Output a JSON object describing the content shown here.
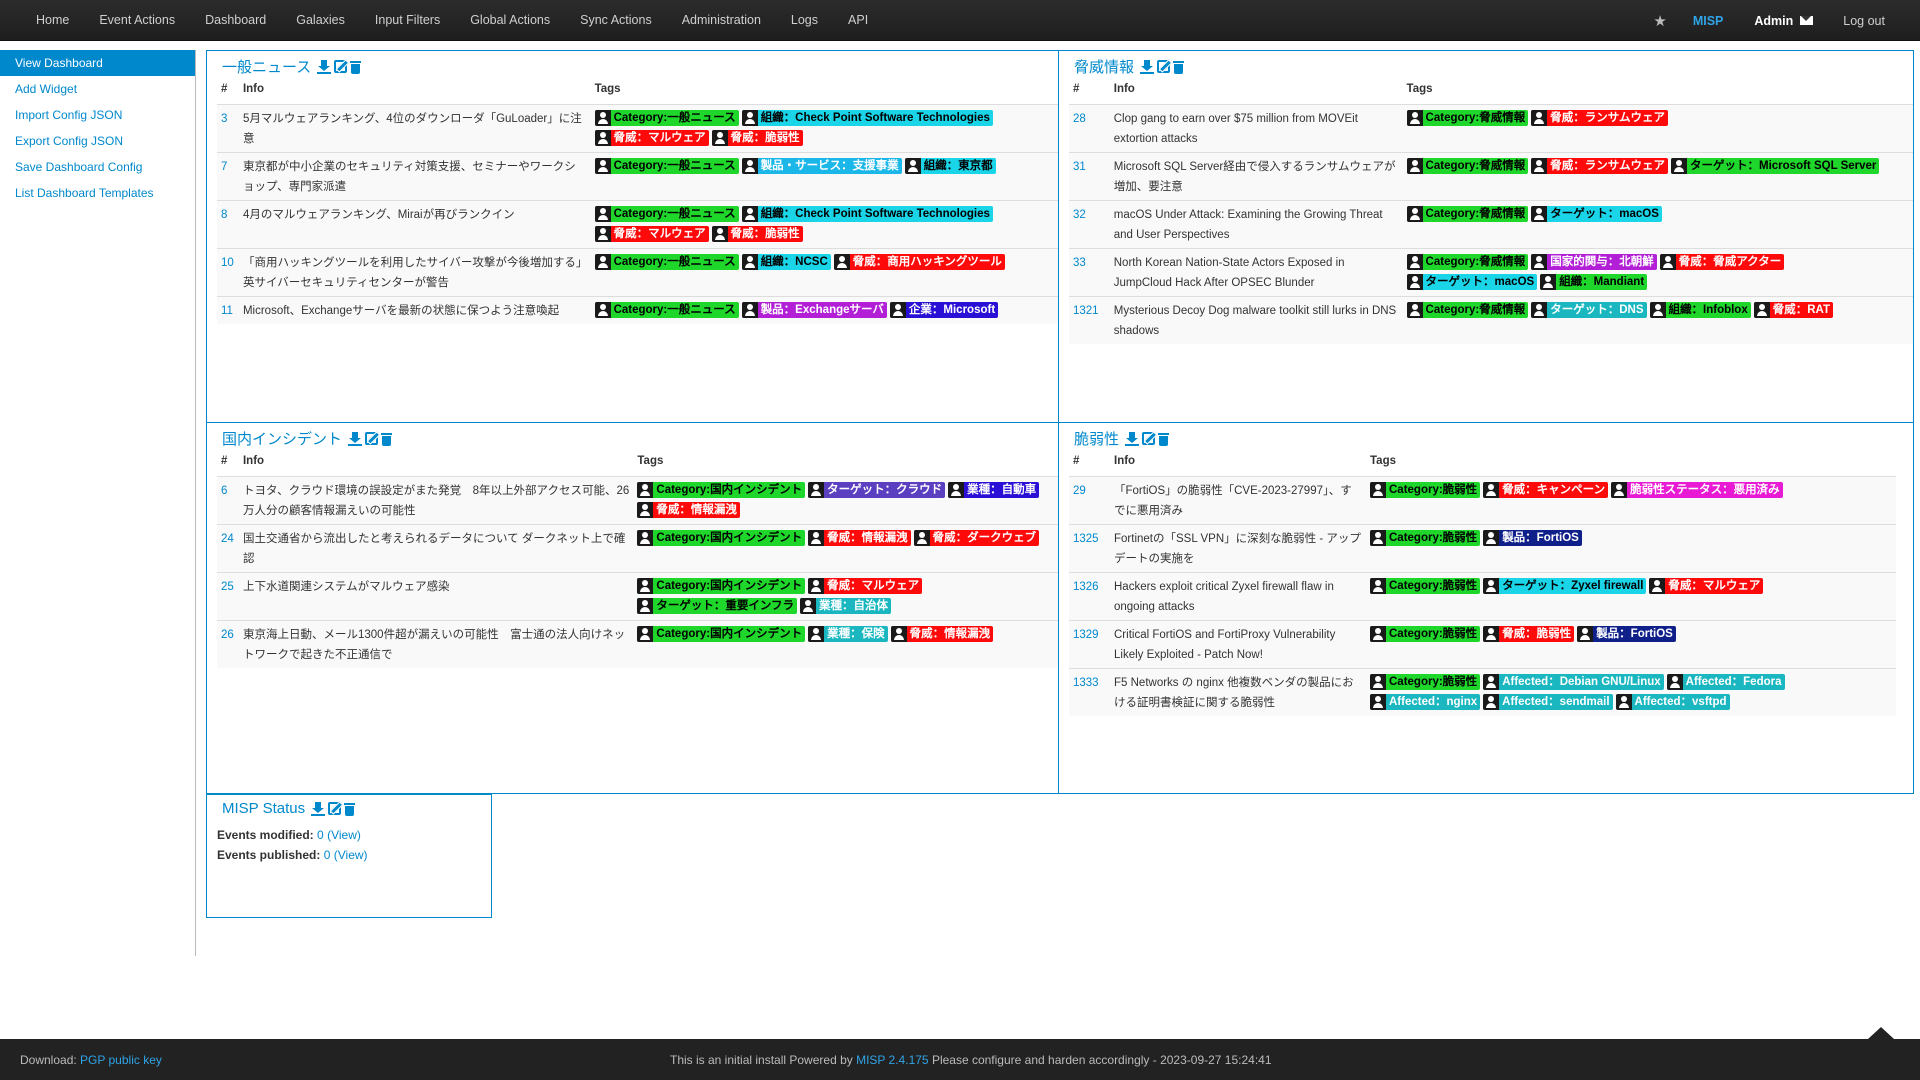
{
  "navbar": {
    "items": [
      "Home",
      "Event Actions",
      "Dashboard",
      "Galaxies",
      "Input Filters",
      "Global Actions",
      "Sync Actions",
      "Administration",
      "Logs",
      "API"
    ],
    "misp": "MISP",
    "user": "Admin",
    "logout": "Log out"
  },
  "sidebar": {
    "items": [
      "View Dashboard",
      "Add Widget",
      "Import Config JSON",
      "Export Config JSON",
      "Save Dashboard Config",
      "List Dashboard Templates"
    ]
  },
  "widgets": {
    "general_news": {
      "title": "一般ニュース",
      "col_id": "#",
      "col_info": "Info",
      "col_tags": "Tags",
      "rows": [
        {
          "id": "3",
          "info": "5月マルウェアランキング、4位のダウンローダ「GuLoader」に注意",
          "tags": [
            {
              "text": "Category:一般ニュース",
              "color": "#1fd62b"
            },
            {
              "text": "組織：Check Point Software Technologies",
              "color": "#1ad4e8"
            },
            {
              "text": "脅威：マルウェア",
              "color": "#ff0a0a"
            },
            {
              "text": "脅威：脆弱性",
              "color": "#ff0a0a"
            }
          ]
        },
        {
          "id": "7",
          "info": "東京都が中小企業のセキュリティ対策支援、セミナーやワークショップ、専門家派遣",
          "tags": [
            {
              "text": "Category:一般ニュース",
              "color": "#1fd62b"
            },
            {
              "text": "製品・サービス：支援事業",
              "color": "#1ab7e8"
            },
            {
              "text": "組織：東京都",
              "color": "#1ad4e8"
            }
          ]
        },
        {
          "id": "8",
          "info": "4月のマルウェアランキング、Miraiが再びランクイン",
          "tags": [
            {
              "text": "Category:一般ニュース",
              "color": "#1fd62b"
            },
            {
              "text": "組織：Check Point Software Technologies",
              "color": "#1ad4e8"
            },
            {
              "text": "脅威：マルウェア",
              "color": "#ff0a0a"
            },
            {
              "text": "脅威：脆弱性",
              "color": "#ff0a0a"
            }
          ]
        },
        {
          "id": "10",
          "info": "「商用ハッキングツールを利用したサイバー攻撃が今後増加する」英サイバーセキュリティセンターが警告",
          "tags": [
            {
              "text": "Category:一般ニュース",
              "color": "#1fd62b"
            },
            {
              "text": "組織：NCSC",
              "color": "#1ad4e8"
            },
            {
              "text": "脅威：商用ハッキングツール",
              "color": "#ff0a0a"
            }
          ]
        },
        {
          "id": "11",
          "info": "Microsoft、Exchangeサーバを最新の状態に保つよう注意喚起",
          "tags": [
            {
              "text": "Category:一般ニュース",
              "color": "#1fd62b"
            },
            {
              "text": "製品：Exchangeサーバ",
              "color": "#b21fd6"
            },
            {
              "text": "企業：Microsoft",
              "color": "#2a10d6"
            }
          ]
        }
      ]
    },
    "threat_info": {
      "title": "脅威情報",
      "col_id": "#",
      "col_info": "Info",
      "col_tags": "Tags",
      "rows": [
        {
          "id": "28",
          "info": "Clop gang to earn over $75 million from MOVEit extortion attacks",
          "tags": [
            {
              "text": "Category:脅威情報",
              "color": "#1fd62b"
            },
            {
              "text": "脅威：ランサムウェア",
              "color": "#ff0a0a"
            }
          ]
        },
        {
          "id": "31",
          "info": "Microsoft SQL Server経由で侵入するランサムウェアが増加、要注意",
          "tags": [
            {
              "text": "Category:脅威情報",
              "color": "#1fd62b"
            },
            {
              "text": "脅威：ランサムウェア",
              "color": "#ff0a0a"
            },
            {
              "text": "ターゲット：Microsoft SQL Server",
              "color": "#1fd62b"
            }
          ]
        },
        {
          "id": "32",
          "info": "macOS Under Attack: Examining the Growing Threat and User Perspectives",
          "tags": [
            {
              "text": "Category:脅威情報",
              "color": "#1fd62b"
            },
            {
              "text": "ターゲット：macOS",
              "color": "#1ad4e8"
            }
          ]
        },
        {
          "id": "33",
          "info": "North Korean Nation-State Actors Exposed in JumpCloud Hack After OPSEC Blunder",
          "tags": [
            {
              "text": "Category:脅威情報",
              "color": "#1fd62b"
            },
            {
              "text": "国家的関与：北朝鮮",
              "color": "#b21fd6"
            },
            {
              "text": "脅威：脅威アクター",
              "color": "#ff0a0a"
            },
            {
              "text": "ターゲット：macOS",
              "color": "#1ad4e8"
            },
            {
              "text": "組織：Mandiant",
              "color": "#1fd62b"
            }
          ]
        },
        {
          "id": "1321",
          "info": "Mysterious Decoy Dog malware toolkit still lurks in DNS shadows",
          "tags": [
            {
              "text": "Category:脅威情報",
              "color": "#1fd62b"
            },
            {
              "text": "ターゲット：DNS",
              "color": "#1ab7c0"
            },
            {
              "text": "組織：Infoblox",
              "color": "#1fd62b"
            },
            {
              "text": "脅威：RAT",
              "color": "#ff0a0a"
            }
          ]
        }
      ]
    },
    "domestic_incidents": {
      "title": "国内インシデント",
      "col_id": "#",
      "col_info": "Info",
      "col_tags": "Tags",
      "rows": [
        {
          "id": "6",
          "info": "トヨタ、クラウド環境の誤設定がまた発覚　8年以上外部アクセス可能、26万人分の顧客情報漏えいの可能性",
          "tags": [
            {
              "text": "Category:国内インシデント",
              "color": "#1fd62b"
            },
            {
              "text": "ターゲット：クラウド",
              "color": "#5a3fc0"
            },
            {
              "text": "業種：自動車",
              "color": "#2a10d6"
            },
            {
              "text": "脅威：情報漏洩",
              "color": "#ff0a0a"
            }
          ]
        },
        {
          "id": "24",
          "info": "国土交通省から流出したと考えられるデータについて ダークネット上で確認",
          "tags": [
            {
              "text": "Category:国内インシデント",
              "color": "#1fd62b"
            },
            {
              "text": "脅威：情報漏洩",
              "color": "#ff0a0a"
            },
            {
              "text": "脅威：ダークウェブ",
              "color": "#ff0a0a"
            }
          ]
        },
        {
          "id": "25",
          "info": "上下水道関連システムがマルウェア感染",
          "tags": [
            {
              "text": "Category:国内インシデント",
              "color": "#1fd62b"
            },
            {
              "text": "脅威：マルウェア",
              "color": "#ff0a0a"
            },
            {
              "text": "ターゲット：重要インフラ",
              "color": "#1fd62b"
            },
            {
              "text": "業種：自治体",
              "color": "#1ab7c0"
            }
          ]
        },
        {
          "id": "26",
          "info": "東京海上日動、メール1300件超が漏えいの可能性　富士通の法人向けネットワークで起きた不正通信で",
          "tags": [
            {
              "text": "Category:国内インシデント",
              "color": "#1fd62b"
            },
            {
              "text": "業種：保険",
              "color": "#1ab7c0"
            },
            {
              "text": "脅威：情報漏洩",
              "color": "#ff0a0a"
            }
          ]
        }
      ]
    },
    "vulnerabilities": {
      "title": "脆弱性",
      "col_id": "#",
      "col_info": "Info",
      "col_tags": "Tags",
      "rows": [
        {
          "id": "29",
          "info": "「FortiOS」の脆弱性「CVE-2023-27997」、すでに悪用済み",
          "tags": [
            {
              "text": "Category:脆弱性",
              "color": "#1fd62b"
            },
            {
              "text": "脅威：キャンペーン",
              "color": "#ff0a0a"
            },
            {
              "text": "脆弱性ステータス：悪用済み",
              "color": "#e81ad4"
            }
          ]
        },
        {
          "id": "1325",
          "info": "Fortinetの「SSL VPN」に深刻な脆弱性 - アップデートの実施を",
          "tags": [
            {
              "text": "Category:脆弱性",
              "color": "#1fd62b"
            },
            {
              "text": "製品：FortiOS",
              "color": "#10208a"
            }
          ]
        },
        {
          "id": "1326",
          "info": "Hackers exploit critical Zyxel firewall flaw in ongoing attacks",
          "tags": [
            {
              "text": "Category:脆弱性",
              "color": "#1fd62b"
            },
            {
              "text": "ターゲット：Zyxel firewall",
              "color": "#1ad4e8"
            },
            {
              "text": "脅威：マルウェア",
              "color": "#ff0a0a"
            }
          ]
        },
        {
          "id": "1329",
          "info": "Critical FortiOS and FortiProxy Vulnerability Likely Exploited - Patch Now!",
          "tags": [
            {
              "text": "Category:脆弱性",
              "color": "#1fd62b"
            },
            {
              "text": "脅威：脆弱性",
              "color": "#ff0a0a"
            },
            {
              "text": "製品：FortiOS",
              "color": "#10208a"
            }
          ]
        },
        {
          "id": "1333",
          "info": "F5 Networks の nginx 他複数ベンダの製品における証明書検証に関する脆弱性",
          "tags": [
            {
              "text": "Category:脆弱性",
              "color": "#1fd62b"
            },
            {
              "text": "Affected：Debian GNU/Linux",
              "color": "#1ab7c0"
            },
            {
              "text": "Affected：Fedora",
              "color": "#1ab7c0"
            },
            {
              "text": "Affected：nginx",
              "color": "#1ab7c0"
            },
            {
              "text": "Affected：sendmail",
              "color": "#1ab7c0"
            },
            {
              "text": "Affected：vsftpd",
              "color": "#1ab7c0"
            }
          ]
        }
      ]
    },
    "misp_status": {
      "title": "MISP Status",
      "events_modified_label": "Events modified:",
      "events_modified_value": "0",
      "events_published_label": "Events published:",
      "events_published_value": "0",
      "view_label": "View"
    }
  },
  "footer": {
    "download_label": "Download:",
    "pgp_link": "PGP public key",
    "center_prefix": "This is an initial install Powered by",
    "center_link": "MISP 2.4.175",
    "center_suffix": "Please configure and harden accordingly - 2023-09-27 15:24:41"
  },
  "colors": {
    "accent": "#0088cc",
    "navbar_bg": "#222222",
    "footer_bg": "#222222"
  }
}
